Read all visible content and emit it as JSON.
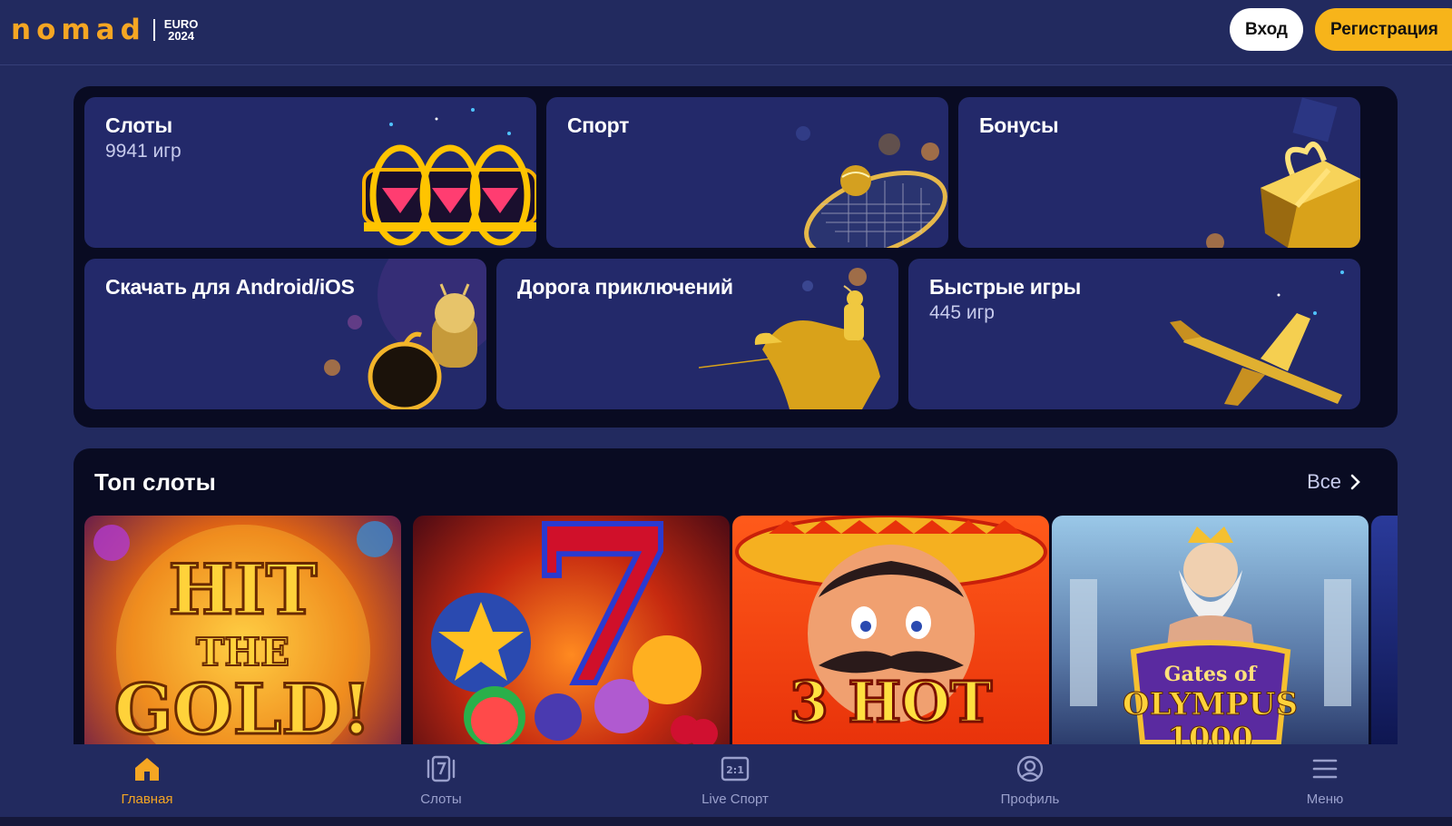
{
  "header": {
    "logo_text": "nomad",
    "logo_badge_line1": "EURO",
    "logo_badge_line2": "2024",
    "login_label": "Вход",
    "register_label": "Регистрация"
  },
  "categories": [
    {
      "title": "Слоты",
      "subtitle": "9941 игр"
    },
    {
      "title": "Спорт",
      "subtitle": ""
    },
    {
      "title": "Бонусы",
      "subtitle": ""
    },
    {
      "title": "Скачать для Android/iOS",
      "subtitle": ""
    },
    {
      "title": "Дорога приключений",
      "subtitle": ""
    },
    {
      "title": "Быстрые игры",
      "subtitle": "445 игр"
    }
  ],
  "top_slots": {
    "title": "Топ слоты",
    "all_label": "Все",
    "games": [
      {
        "art_line1": "HIT",
        "art_line2": "THE",
        "art_line3": "GOLD!"
      },
      {
        "art_line1": "7",
        "art_line2": "",
        "art_line3": ""
      },
      {
        "art_line1": "3 HOT",
        "art_line2": "",
        "art_line3": ""
      },
      {
        "art_line1": "Gates of",
        "art_line2": "OLYMPUS",
        "art_line3": "1000"
      }
    ]
  },
  "bottom_nav": [
    {
      "label": "Главная",
      "icon": "home-icon",
      "active": true
    },
    {
      "label": "Слоты",
      "icon": "slots-icon",
      "active": false
    },
    {
      "label": "Live Спорт",
      "icon": "live-sport-icon",
      "active": false
    },
    {
      "label": "Профиль",
      "icon": "profile-icon",
      "active": false
    },
    {
      "label": "Меню",
      "icon": "menu-icon",
      "active": false
    }
  ],
  "colors": {
    "background": "#222a5f",
    "panel": "#090b22",
    "tile": "#23296a",
    "accent": "#f5a623",
    "register_button": "#f7b41a"
  }
}
